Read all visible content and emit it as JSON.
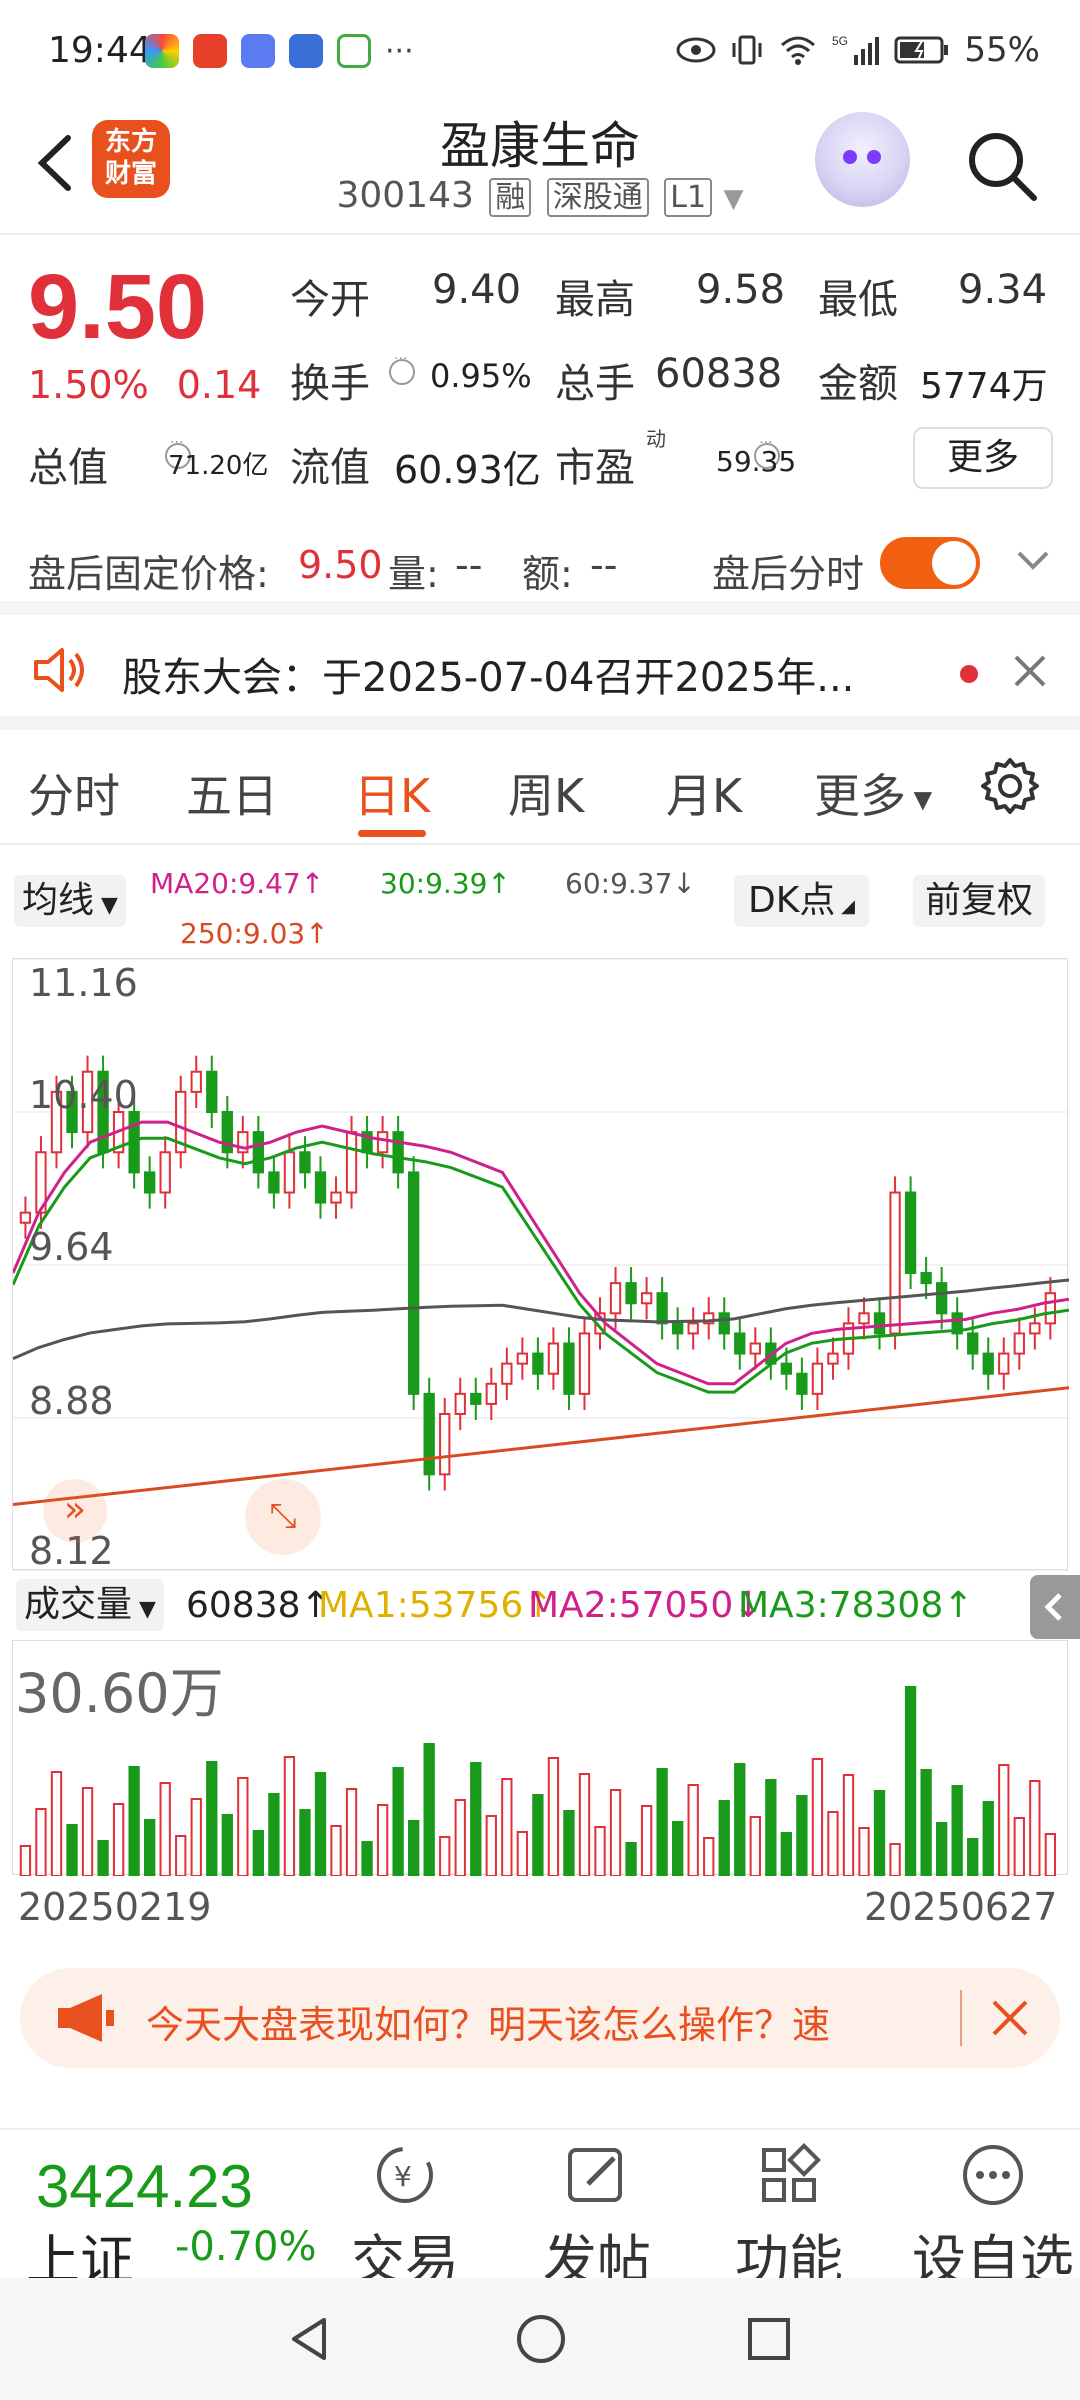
{
  "status_bar": {
    "time": "19:44",
    "extra": "···",
    "battery": "55%"
  },
  "header": {
    "logo_line1": "东方",
    "logo_line2": "财富",
    "title": "盈康生命",
    "code": "300143",
    "tags": [
      "融",
      "深股通",
      "L1"
    ]
  },
  "quote": {
    "price": "9.50",
    "change_pct": "1.50%",
    "change_abs": "0.14",
    "open_label": "今开",
    "open": "9.40",
    "high_label": "最高",
    "high": "9.58",
    "low_label": "最低",
    "low": "9.34",
    "turnover_label": "换手",
    "turnover": "0.95%",
    "volume_label": "总手",
    "volume": "60838",
    "amount_label": "金额",
    "amount": "5774万",
    "mktcap_label": "总值",
    "mktcap": "71.20亿",
    "float_label": "流值",
    "float": "60.93亿",
    "pe_label": "市盈",
    "pe_sup": "动",
    "pe": "59.35",
    "more_label": "更多"
  },
  "after_hours": {
    "price_label": "盘后固定价格:",
    "price": "9.50",
    "vol_label": "量:",
    "vol": "--",
    "amt_label": "额:",
    "amt": "--",
    "minute_label": "盘后分时"
  },
  "notice": {
    "text": "股东大会：于2025-07-04召开2025年..."
  },
  "tabs": [
    "分时",
    "五日",
    "日K",
    "周K",
    "月K",
    "更多"
  ],
  "ma_legend": {
    "select": "均线",
    "ma20": "MA20:9.47↑",
    "ma30": "30:9.39↑",
    "ma60": "60:9.37↓",
    "ma250": "250:9.03↑",
    "dk": "DK点",
    "fq": "前复权"
  },
  "price_axis": [
    "11.16",
    "10.40",
    "9.64",
    "8.88",
    "8.12"
  ],
  "volume_legend": {
    "select": "成交量",
    "vol": "60838↑",
    "ma1": "MA1:53756↑",
    "ma2": "MA2:57050↓",
    "ma3": "MA3:78308↑",
    "max": "30.60万"
  },
  "dates": {
    "start": "20250219",
    "end": "20250627"
  },
  "banner": {
    "text": "今天大盘表现如何？明天该怎么操作？速"
  },
  "bottom_bar": {
    "index_value": "3424.23",
    "index_name": "上证",
    "index_change": "-0.70%",
    "items": [
      "交易",
      "发帖",
      "功能",
      "设自选"
    ]
  },
  "colors": {
    "up": "#e0303a",
    "down": "#1a9a1a",
    "ma20": "#d0208a",
    "ma30": "#1a9a1a",
    "ma60": "#555555",
    "ma250": "#d84a20",
    "ma1": "#e0b000",
    "accent": "#e8501e"
  },
  "chart_data": {
    "type": "candlestick",
    "price_ticks": [
      11.16,
      10.4,
      9.64,
      8.88,
      8.12
    ],
    "ylim": [
      8.12,
      11.16
    ],
    "date_range": [
      "20250219",
      "20250627"
    ],
    "close_approx": [
      9.9,
      10.2,
      10.5,
      10.3,
      10.6,
      10.2,
      10.4,
      10.1,
      10.0,
      10.2,
      10.5,
      10.6,
      10.4,
      10.2,
      10.3,
      10.1,
      10.0,
      10.2,
      10.1,
      9.95,
      10.0,
      10.3,
      10.2,
      10.3,
      10.1,
      9.0,
      8.6,
      8.9,
      9.0,
      8.95,
      9.05,
      9.15,
      9.2,
      9.1,
      9.25,
      9.0,
      9.3,
      9.4,
      9.55,
      9.45,
      9.5,
      9.35,
      9.3,
      9.35,
      9.4,
      9.3,
      9.2,
      9.25,
      9.15,
      9.1,
      9.0,
      9.15,
      9.2,
      9.35,
      9.4,
      9.3,
      10.0,
      9.6,
      9.55,
      9.4,
      9.3,
      9.2,
      9.1,
      9.2,
      9.3,
      9.35,
      9.5
    ],
    "ma20_approx": [
      9.6,
      9.9,
      10.1,
      10.25,
      10.3,
      10.35,
      10.35,
      10.3,
      10.25,
      10.22,
      10.25,
      10.3,
      10.33,
      10.3,
      10.27,
      10.25,
      10.23,
      10.2,
      10.15,
      10.1,
      9.9,
      9.7,
      9.5,
      9.35,
      9.25,
      9.15,
      9.1,
      9.05,
      9.05,
      9.15,
      9.25,
      9.3,
      9.32,
      9.33,
      9.34,
      9.35,
      9.36,
      9.37,
      9.4,
      9.42,
      9.45,
      9.47
    ],
    "volume_max": "30.60万"
  }
}
